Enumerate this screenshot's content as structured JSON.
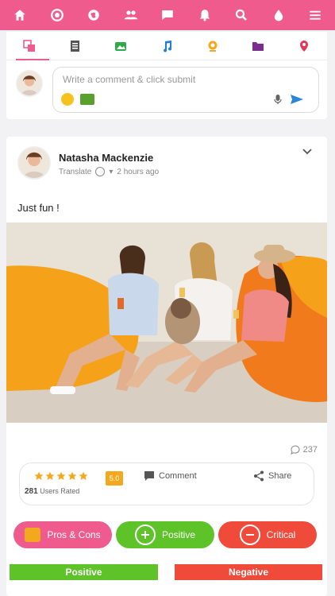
{
  "topbar": {
    "icons": [
      "home-icon",
      "circle-dot-icon",
      "globe-icon",
      "group-icon",
      "chat-icon",
      "bell-icon",
      "search-icon",
      "drop-icon",
      "menu-icon"
    ],
    "color": "#ef5b8c"
  },
  "composer": {
    "media_tabs": [
      "copy-icon",
      "document-icon",
      "photo-icon",
      "music-icon",
      "webcam-icon",
      "folder-icon",
      "location-icon"
    ],
    "placeholder": "Write a comment & click submit"
  },
  "post": {
    "author": "Natasha Mackenzie",
    "translate": "Translate",
    "time": "2 hours ago",
    "text": "Just fun !",
    "comments_count": "237",
    "rating_count": "281",
    "rated_label": "Users Rated",
    "score": "5.0",
    "stars": 5,
    "comment_label": "Comment",
    "share_label": "Share"
  },
  "reactions": {
    "pros_cons": "Pros & Cons",
    "positive": "Positive",
    "critical": "Critical"
  },
  "summary": {
    "positive": "Positive",
    "negative": "Negative"
  }
}
